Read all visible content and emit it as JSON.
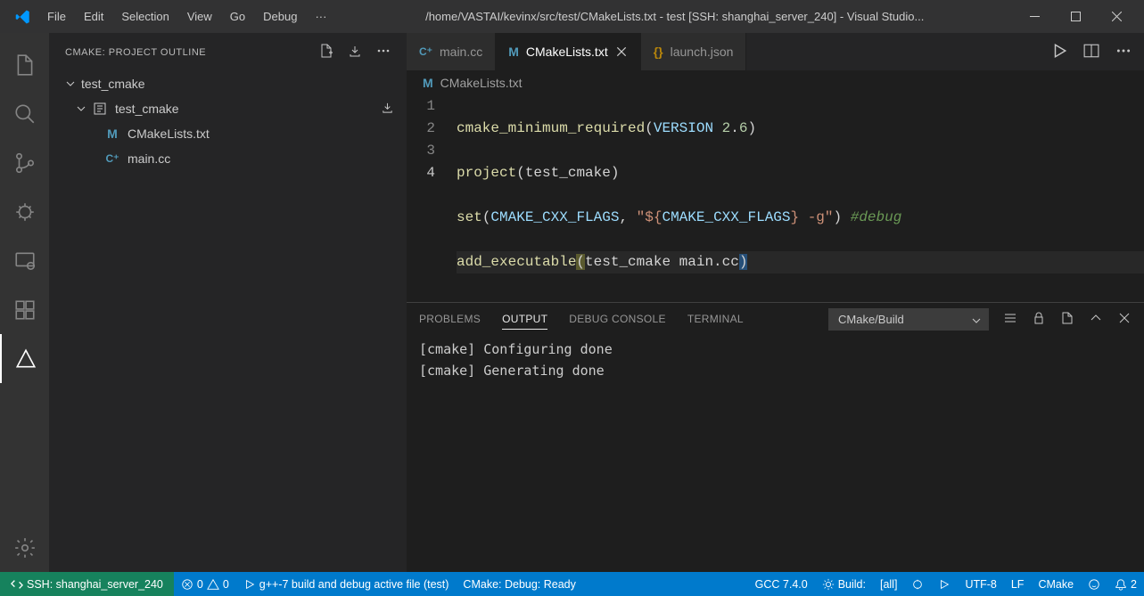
{
  "window": {
    "title": "/home/VASTAI/kevinx/src/test/CMakeLists.txt - test [SSH: shanghai_server_240] - Visual Studio..."
  },
  "menu": {
    "file": "File",
    "edit": "Edit",
    "selection": "Selection",
    "view": "View",
    "go": "Go",
    "debug": "Debug",
    "more": "···"
  },
  "sidebar": {
    "title": "CMAKE: PROJECT OUTLINE",
    "tree": {
      "root": "test_cmake",
      "proj": "test_cmake",
      "f1": "CMakeLists.txt",
      "f2": "main.cc"
    }
  },
  "tabs": {
    "t1": "main.cc",
    "t2": "CMakeLists.txt",
    "t3": "launch.json"
  },
  "breadcrumb": {
    "b1": "CMakeLists.txt"
  },
  "code": {
    "lines": [
      "1",
      "2",
      "3",
      "4"
    ],
    "l1_func": "cmake_minimum_required",
    "l1_a": "(",
    "l1_ver": "VERSION",
    "l1_num1": " 2",
    "l1_dot": ".",
    "l1_num2": "6",
    "l1_b": ")",
    "l2_func": "project",
    "l2_a": "(",
    "l2_arg": "test_cmake",
    "l2_b": ")",
    "l3_func": "set",
    "l3_a": "(",
    "l3_v1": "CMAKE_CXX_FLAGS",
    "l3_c": ", ",
    "l3_s1": "\"${",
    "l3_v2": "CMAKE_CXX_FLAGS",
    "l3_s2": "} -g\"",
    "l3_b": ") ",
    "l3_comment": "#debug",
    "l4_func": "add_executable",
    "l4_a": "(",
    "l4_args": "test_cmake main.cc",
    "l4_b": ")"
  },
  "panel": {
    "tabs": {
      "problems": "PROBLEMS",
      "output": "OUTPUT",
      "debug": "DEBUG CONSOLE",
      "terminal": "TERMINAL"
    },
    "select": "CMake/Build",
    "output_lines": [
      "[cmake] Configuring done",
      "[cmake] Generating done"
    ]
  },
  "status": {
    "remote": "SSH: shanghai_server_240",
    "errors": "0",
    "warnings": "0",
    "build_task": "g++-7 build and debug active file (test)",
    "cmake_status": "CMake: Debug: Ready",
    "compiler": "GCC 7.4.0",
    "build_lbl": "Build:",
    "build_tgt": "[all]",
    "encoding": "UTF-8",
    "eol": "LF",
    "lang": "CMake",
    "notifications": "2"
  }
}
